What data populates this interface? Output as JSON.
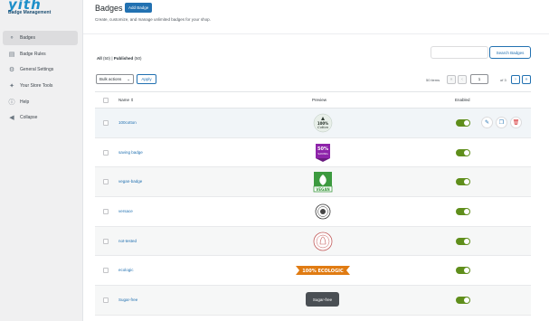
{
  "sidebar": {
    "brand": "yith",
    "subtitle": "Badge Management",
    "items": [
      {
        "label": "Badges",
        "icon": "tag-icon"
      },
      {
        "label": "Badge Rules",
        "icon": "rules-icon"
      },
      {
        "label": "General Settings",
        "icon": "gear-icon"
      },
      {
        "label": "Your Store Tools",
        "icon": "tools-icon"
      },
      {
        "label": "Help",
        "icon": "help-icon"
      },
      {
        "label": "Collapse",
        "icon": "collapse-icon"
      }
    ]
  },
  "header": {
    "title": "Badges",
    "add_label": "Add Badge",
    "subtitle": "Create, customize, and manage unlimited badges for your shop."
  },
  "filters": {
    "all_label": "All",
    "all_count": "(50)",
    "sep": "|",
    "published_label": "Published",
    "published_count": "(50)"
  },
  "search": {
    "placeholder": "",
    "button_label": "Search Badges"
  },
  "bulk": {
    "selected": "Bulk actions",
    "apply_label": "Apply"
  },
  "pagination": {
    "items_label": "50 items",
    "first": "«",
    "prev": "‹",
    "current_page": "1",
    "of_label": "of 3",
    "next": "›",
    "last": "»"
  },
  "table": {
    "headers": {
      "name": "Name",
      "sort_icon": "⇕",
      "preview": "Preview",
      "enabled": "Enabled"
    },
    "rows": [
      {
        "name": "100cotton",
        "preview_text": "100% Cotton",
        "enabled": true
      },
      {
        "name": "saving badge",
        "preview_text": "50% SAVING",
        "enabled": true
      },
      {
        "name": "vegan-badge",
        "preview_text": "VEGAN",
        "enabled": true
      },
      {
        "name": "versace",
        "preview_text": "",
        "enabled": true
      },
      {
        "name": "not-tested",
        "preview_text": "",
        "enabled": true
      },
      {
        "name": "ecologic",
        "preview_text": "100% ECOLOGIC",
        "enabled": true
      },
      {
        "name": "Sugar-free",
        "preview_text": "",
        "enabled": true
      }
    ]
  },
  "tooltip": "Sugar-free",
  "colors": {
    "accent": "#2271b1",
    "toggle_on": "#5f8e1b",
    "saving_purple": "#8e24aa",
    "vegan_green": "#3c9a3f",
    "ecologic_orange": "#e07b12"
  }
}
